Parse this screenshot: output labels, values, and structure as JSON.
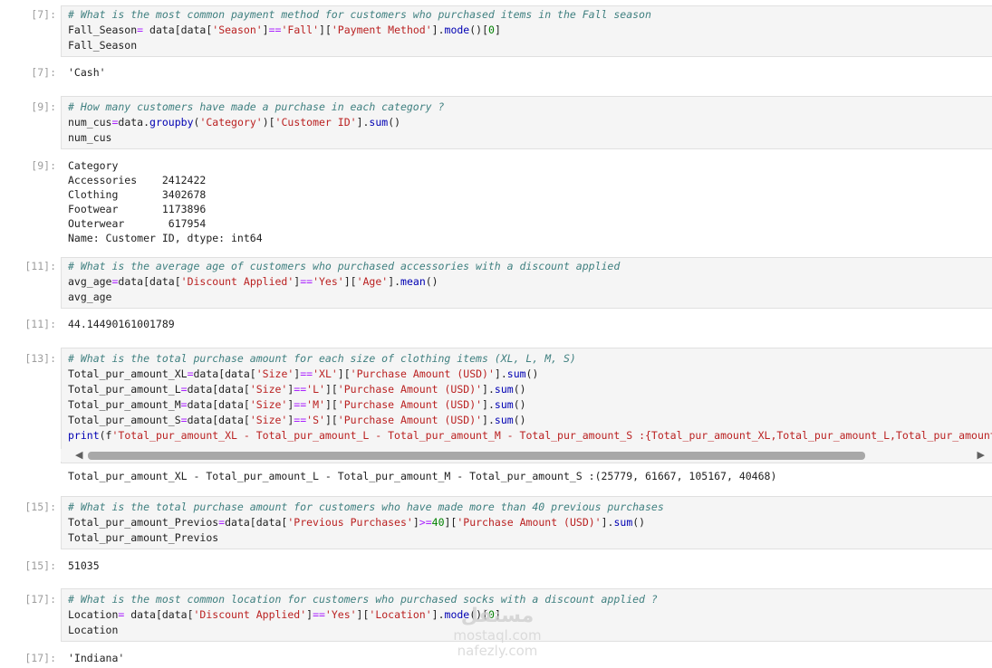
{
  "cells": [
    {
      "in_prompt": "[7]:",
      "out_prompt": "[7]:",
      "code": [
        "# What is the most common payment method for customers who purchased items in the Fall season",
        "Fall_Season= data[data['Season']=='Fall']['Payment Method'].mode()[0]",
        "Fall_Season"
      ],
      "output": [
        "'Cash'"
      ]
    },
    {
      "in_prompt": "[9]:",
      "out_prompt": "[9]:",
      "code": [
        "# How many customers have made a purchase in each category ?",
        "num_cus=data.groupby('Category')['Customer ID'].sum()",
        "num_cus"
      ],
      "output": [
        "Category",
        "Accessories    2412422",
        "Clothing       3402678",
        "Footwear       1173896",
        "Outerwear       617954",
        "Name: Customer ID, dtype: int64"
      ]
    },
    {
      "in_prompt": "[11]:",
      "out_prompt": "[11]:",
      "code": [
        "# What is the average age of customers who purchased accessories with a discount applied",
        "avg_age=data[data['Discount Applied']=='Yes']['Age'].mean()",
        "avg_age"
      ],
      "output": [
        "44.14490161001789"
      ]
    },
    {
      "in_prompt": "[13]:",
      "out_prompt": "",
      "code": [
        "# What is the total purchase amount for each size of clothing items (XL, L, M, S)",
        "Total_pur_amount_XL=data[data['Size']=='XL']['Purchase Amount (USD)'].sum()",
        "Total_pur_amount_L=data[data['Size']=='L']['Purchase Amount (USD)'].sum()",
        "Total_pur_amount_M=data[data['Size']=='M']['Purchase Amount (USD)'].sum()",
        "Total_pur_amount_S=data[data['Size']=='S']['Purchase Amount (USD)'].sum()",
        "print(f'Total_pur_amount_XL - Total_pur_amount_L - Total_pur_amount_M - Total_pur_amount_S :{Total_pur_amount_XL,Total_pur_amount_L,Total_pur_amount_M,To"
      ],
      "output": [
        "Total_pur_amount_XL - Total_pur_amount_L - Total_pur_amount_M - Total_pur_amount_S :(25779, 61667, 105167, 40468)"
      ]
    },
    {
      "in_prompt": "[15]:",
      "out_prompt": "[15]:",
      "code": [
        "# What is the total purchase amount for customers who have made more than 40 previous purchases",
        "Total_pur_amount_Previos=data[data['Previous Purchases']>=40]['Purchase Amount (USD)'].sum()",
        "Total_pur_amount_Previos"
      ],
      "output": [
        "51035"
      ]
    },
    {
      "in_prompt": "[17]:",
      "out_prompt": "[17]:",
      "code": [
        "# What is the most common location for customers who purchased socks with a discount applied ?",
        "Location= data[data['Discount Applied']=='Yes']['Location'].mode()[0]",
        "Location"
      ],
      "output": [
        "'Indiana'"
      ]
    }
  ],
  "scrollbar": {
    "left_arrow": "◀",
    "right_arrow": "▶"
  },
  "watermark": {
    "logo": "مستقل",
    "line1": "mostaql.com",
    "line2": "nafezly.com"
  },
  "colors": {
    "comment": "#408080",
    "string": "#ba2121",
    "builtin": "#0000b3",
    "number": "#008000",
    "operator": "#aa22ff",
    "prompt": "#9e9e9e",
    "input_bg": "#f5f5f5"
  }
}
